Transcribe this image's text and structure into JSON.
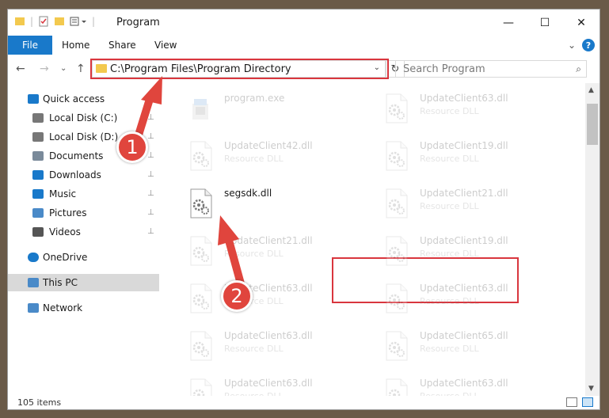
{
  "window": {
    "title": "Program",
    "minimize_glyph": "—",
    "maximize_glyph": "☐",
    "close_glyph": "✕"
  },
  "ribbon": {
    "tabs": [
      "File",
      "Home",
      "Share",
      "View"
    ],
    "help": "?",
    "expand_glyph": "⌄"
  },
  "nav": {
    "back": "←",
    "forward": "→",
    "recent": "⌄",
    "up": "↑",
    "address": "C:\\Program Files\\Program Directory",
    "address_caret": "⌄",
    "refresh": "↻",
    "search_placeholder": "Search Program",
    "search_glyph": "⌕"
  },
  "sidebar": {
    "items": [
      {
        "label": "Quick access",
        "icon": "star-icon",
        "pinned": false,
        "indent": 0
      },
      {
        "label": "Local Disk (C:)",
        "icon": "drive-icon",
        "pinned": true,
        "indent": 1
      },
      {
        "label": "Local Disk (D:)",
        "icon": "drive-icon",
        "pinned": true,
        "indent": 1
      },
      {
        "label": "Documents",
        "icon": "documents-icon",
        "pinned": true,
        "indent": 1
      },
      {
        "label": "Downloads",
        "icon": "download-icon",
        "pinned": true,
        "indent": 1
      },
      {
        "label": "Music",
        "icon": "music-icon",
        "pinned": true,
        "indent": 1
      },
      {
        "label": "Pictures",
        "icon": "pictures-icon",
        "pinned": true,
        "indent": 1
      },
      {
        "label": "Videos",
        "icon": "videos-icon",
        "pinned": true,
        "indent": 1
      },
      {
        "label": "OneDrive",
        "icon": "cloud-icon",
        "pinned": false,
        "indent": 0
      },
      {
        "label": "This PC",
        "icon": "computer-icon",
        "pinned": false,
        "indent": 0,
        "selected": true
      },
      {
        "label": "Network",
        "icon": "network-icon",
        "pinned": false,
        "indent": 0
      }
    ],
    "pin_glyph": "📌"
  },
  "files": {
    "left": [
      {
        "name": "program.exe",
        "desc": "",
        "faded": true,
        "type": "exe"
      },
      {
        "name": "UpdateClient42.dll",
        "desc": "Resource DLL",
        "faded": true,
        "type": "dll"
      },
      {
        "name": "segsdk.dll",
        "desc": "",
        "faded": false,
        "type": "dll"
      },
      {
        "name": "UpdateClient21.dll",
        "desc": "Resource DLL",
        "faded": true,
        "type": "dll"
      },
      {
        "name": "UpdateClient63.dll",
        "desc": "Resource DLL",
        "faded": true,
        "type": "dll"
      },
      {
        "name": "UpdateClient63.dll",
        "desc": "Resource DLL",
        "faded": true,
        "type": "dll"
      },
      {
        "name": "UpdateClient63.dll",
        "desc": "Resource DLL",
        "faded": true,
        "type": "dll"
      }
    ],
    "right": [
      {
        "name": "UpdateClient63.dll",
        "desc": "Resource DLL",
        "faded": true
      },
      {
        "name": "UpdateClient19.dll",
        "desc": "Resource DLL",
        "faded": true
      },
      {
        "name": "UpdateClient21.dll",
        "desc": "Resource DLL",
        "faded": true
      },
      {
        "name": "UpdateClient19.dll",
        "desc": "Resource DLL",
        "faded": true
      },
      {
        "name": "UpdateClient63.dll",
        "desc": "Resource DLL",
        "faded": true
      },
      {
        "name": "UpdateClient65.dll",
        "desc": "Resource DLL",
        "faded": true
      },
      {
        "name": "UpdateClient63.dll",
        "desc": "Resource DLL",
        "faded": true
      }
    ]
  },
  "status": {
    "count": "105 items"
  },
  "callouts": [
    "1",
    "2"
  ],
  "colors": {
    "accent": "#1979ca",
    "highlight": "#d9363e",
    "callout": "#e0453d",
    "folder": "#f3c94e"
  }
}
